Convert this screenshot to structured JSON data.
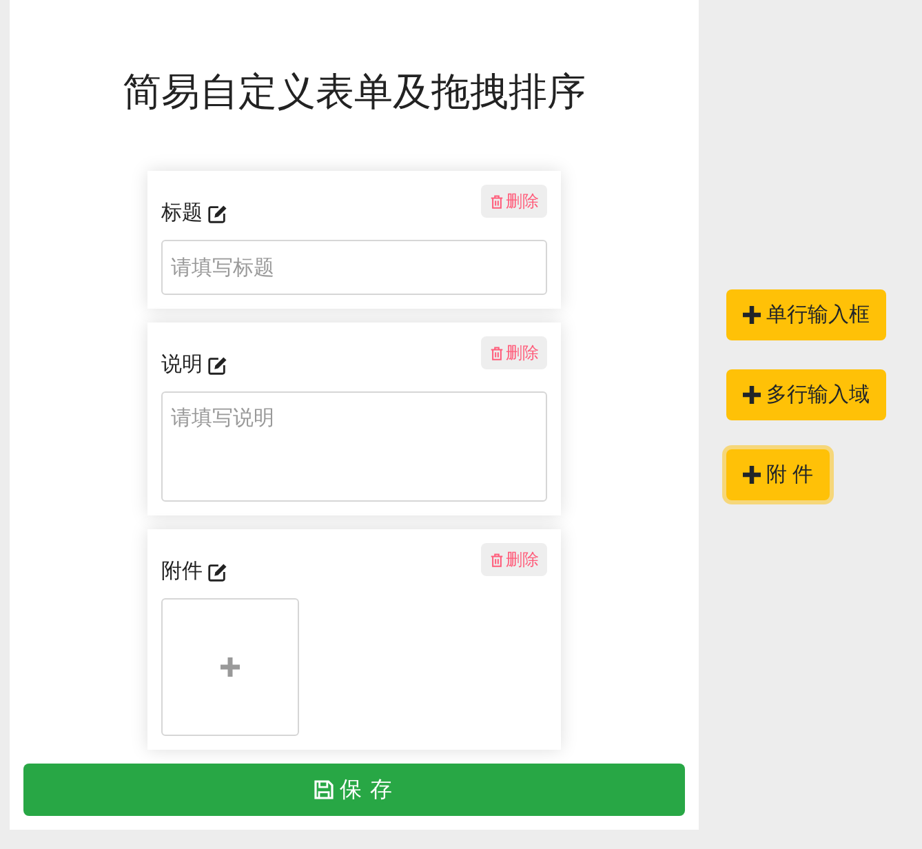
{
  "title": "简易自定义表单及拖拽排序",
  "fields": [
    {
      "kind": "input",
      "label": "标题",
      "placeholder": "请填写标题",
      "delete_label": "删除"
    },
    {
      "kind": "textarea",
      "label": "说明",
      "placeholder": "请填写说明",
      "delete_label": "删除"
    },
    {
      "kind": "upload",
      "label": "附件",
      "delete_label": "删除"
    }
  ],
  "save_button": {
    "label": "保 存"
  },
  "add_buttons": [
    {
      "label": "单行输入框",
      "focused": false
    },
    {
      "label": "多行输入域",
      "focused": false
    },
    {
      "label": "附 件",
      "focused": true
    }
  ]
}
